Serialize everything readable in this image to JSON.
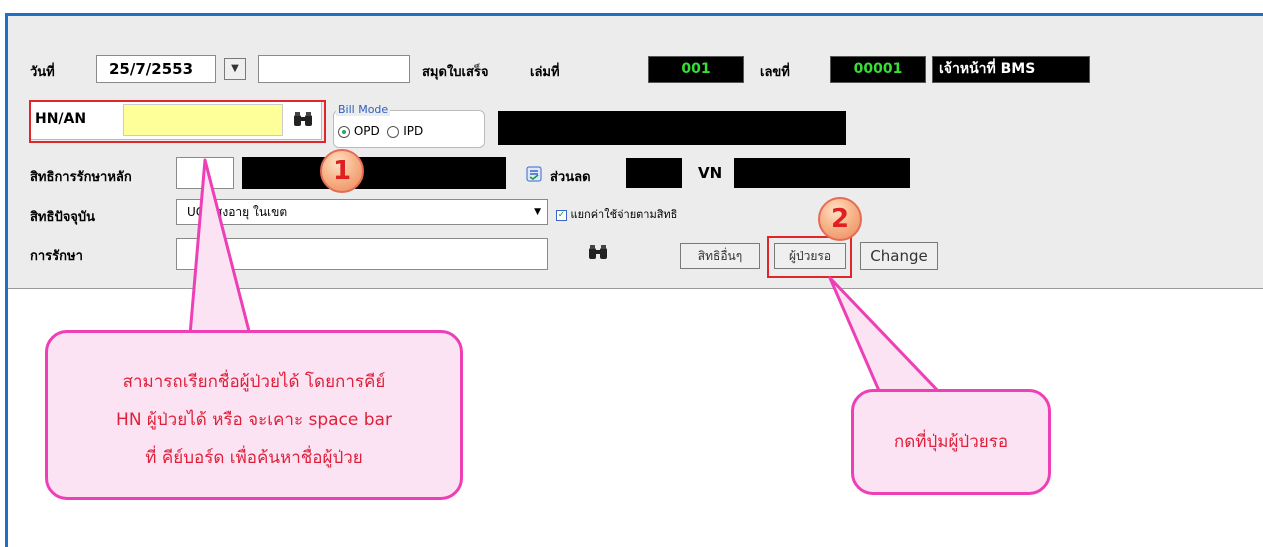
{
  "header": {
    "date_label": "วันที่",
    "date_value": "25/7/2553",
    "receipt_book_label": "สมุดใบเสร็จ",
    "volume_label": "เล่มที่",
    "volume_value": "001",
    "number_label": "เลขที่",
    "number_value": "00001",
    "staff_label": "เจ้าหน้าที่ BMS"
  },
  "hn": {
    "label": "HN/AN",
    "value": ""
  },
  "bill_mode": {
    "label": "Bill Mode",
    "options": [
      "OPD",
      "IPD"
    ],
    "selected": "OPD"
  },
  "rights": {
    "main_label": "สิทธิการรักษาหลัก",
    "discount_label": "ส่วนลด",
    "vn_label": "VN",
    "current_label": "สิทธิปัจจุบัน",
    "current_value": "UC ผู้สูงอายุ ในเขต",
    "split_label": "แยกค่าใช้จ่ายตามสิทธิ",
    "treatment_label": "การรักษา"
  },
  "buttons": {
    "other_rights": "สิทธิอื่นๆ",
    "waiting_patients": "ผู้ป่วยรอ",
    "change": "Change"
  },
  "annotations": {
    "step1": "1",
    "step2": "2",
    "callout1_line1": "สามารถเรียกชื่อผู้ป่วยได้ โดยการคีย์",
    "callout1_line2": "HN ผู้ป่วยได้ หรือ จะเคาะ space bar",
    "callout1_line3": "ที่ คีย์บอร์ด เพื่อค้นหาชื่อผู้ป่วย",
    "callout2": "กดที่ปุ่มผู้ป่วยรอ"
  }
}
